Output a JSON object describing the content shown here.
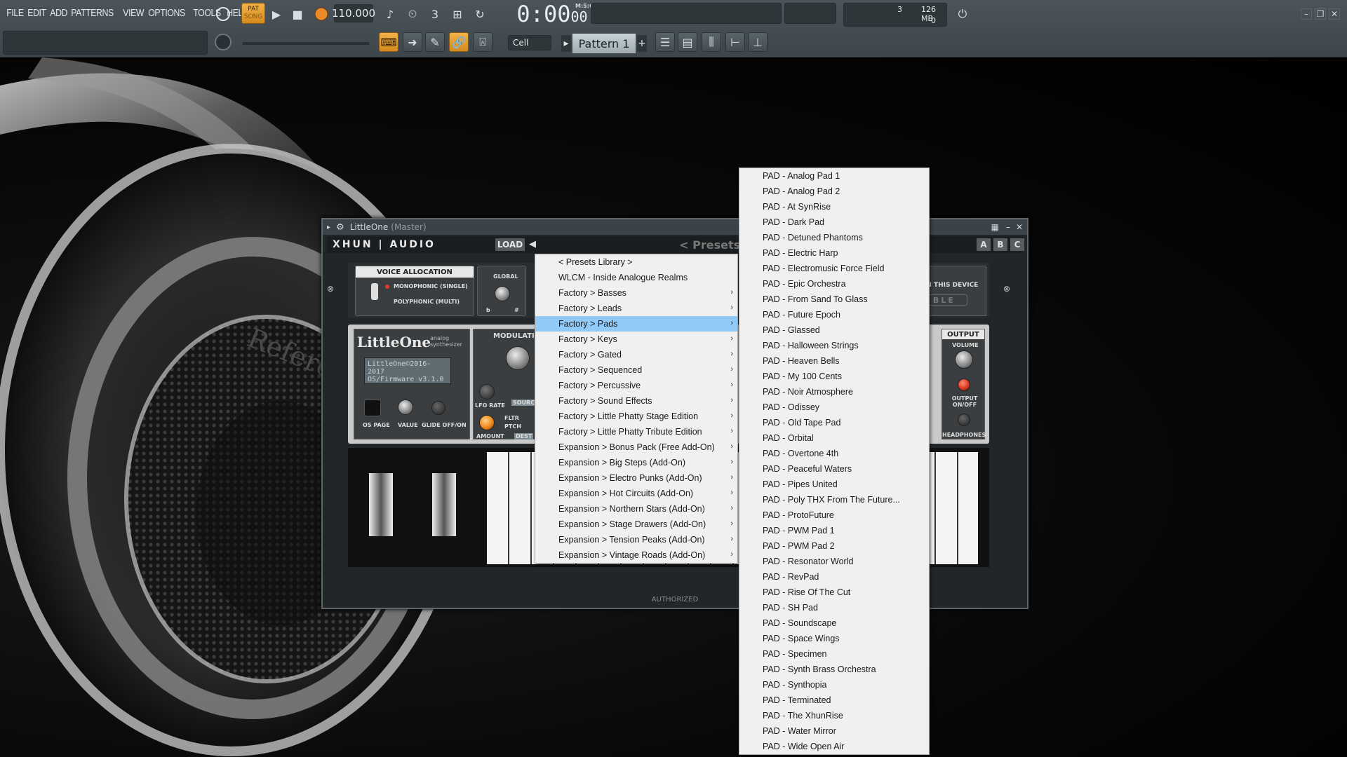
{
  "menubar": [
    "FILE",
    "EDIT",
    "ADD",
    "PATTERNS",
    "VIEW",
    "OPTIONS",
    "TOOLS",
    "HELP"
  ],
  "transport": {
    "pat_label": "PAT",
    "song_label": "SONG",
    "tempo": "110.000",
    "time_main": "0:00",
    "time_sub": "00",
    "time_unit": "M:S:CS"
  },
  "cpu": {
    "voices": "3",
    "memory": "126 MB",
    "second": "0"
  },
  "toolbar2": {
    "snap": "Cell",
    "pattern": "Pattern 1"
  },
  "plugin": {
    "title": "LittleOne",
    "subtitle": "(Master)",
    "brand": "XHUN | AUDIO",
    "load": "LOAD",
    "preset_title": "< Presets Library >",
    "abc": [
      "A",
      "B",
      "C"
    ],
    "voice_allocation": "VOICE ALLOCATION",
    "mono": "MONOPHONIC (SINGLE)",
    "poly": "POLYPHONIC (MULTI)",
    "global": "GLOBAL",
    "modulation": "MODULATIO",
    "in_device": "IN THIS DEVICE",
    "device_state": "BLE",
    "synth_name": "LittleOne",
    "synth_sub": "analog synthesizer",
    "lcd_line1": "LittleOne©2016-2017",
    "lcd_line2": "OS/Firmware   v3.1.0",
    "os_page": "OS PAGE",
    "value": "VALUE",
    "glide": "GLIDE OFF/ON",
    "lfo_rate": "LFO RATE",
    "amount": "AMOUNT",
    "source": "SOURC",
    "dest": "DEST",
    "fltr": "FLTR",
    "ptch": "PTCH",
    "output": "OUTPUT",
    "volume": "VOLUME",
    "output_onoff": "OUTPUT ON/OFF",
    "headphones": "HEADPHONES",
    "flat": "b",
    "sharp": "#",
    "authorized": "AUTHORIZED"
  },
  "menu1": [
    {
      "label": "< Presets Library >",
      "sub": false
    },
    {
      "label": "WLCM - Inside Analogue Realms",
      "sub": false
    },
    {
      "label": "Factory > Basses",
      "sub": true
    },
    {
      "label": "Factory > Leads",
      "sub": true
    },
    {
      "label": "Factory > Pads",
      "sub": true,
      "selected": true
    },
    {
      "label": "Factory > Keys",
      "sub": true
    },
    {
      "label": "Factory > Gated",
      "sub": true
    },
    {
      "label": "Factory > Sequenced",
      "sub": true
    },
    {
      "label": "Factory > Percussive",
      "sub": true
    },
    {
      "label": "Factory > Sound Effects",
      "sub": true
    },
    {
      "label": "Factory > Little Phatty Stage Edition",
      "sub": true
    },
    {
      "label": "Factory > Little Phatty Tribute Edition",
      "sub": true
    },
    {
      "label": "Expansion > Bonus Pack (Free Add-On)",
      "sub": true
    },
    {
      "label": "Expansion > Big Steps (Add-On)",
      "sub": true
    },
    {
      "label": "Expansion > Electro Punks (Add-On)",
      "sub": true
    },
    {
      "label": "Expansion > Hot Circuits (Add-On)",
      "sub": true
    },
    {
      "label": "Expansion > Northern Stars (Add-On)",
      "sub": true
    },
    {
      "label": "Expansion > Stage Drawers (Add-On)",
      "sub": true
    },
    {
      "label": "Expansion > Tension Peaks (Add-On)",
      "sub": true
    },
    {
      "label": "Expansion > Vintage Roads (Add-On)",
      "sub": true
    }
  ],
  "menu2": [
    "PAD - Analog Pad 1",
    "PAD - Analog Pad 2",
    "PAD - At SynRise",
    "PAD - Dark Pad",
    "PAD - Detuned Phantoms",
    "PAD - Electric Harp",
    "PAD - Electromusic Force Field",
    "PAD - Epic Orchestra",
    "PAD - From Sand To Glass",
    "PAD - Future Epoch",
    "PAD - Glassed",
    "PAD - Halloween Strings",
    "PAD - Heaven Bells",
    "PAD - My 100 Cents",
    "PAD - Noir Atmosphere",
    "PAD - Odissey",
    "PAD - Old Tape Pad",
    "PAD - Orbital",
    "PAD - Overtone 4th",
    "PAD - Peaceful Waters",
    "PAD - Pipes United",
    "PAD - Poly THX From The Future...",
    "PAD - ProtoFuture",
    "PAD - PWM Pad 1",
    "PAD - PWM Pad 2",
    "PAD - Resonator World",
    "PAD - RevPad",
    "PAD - Rise Of The Cut",
    "PAD - SH Pad",
    "PAD - Soundscape",
    "PAD - Space Wings",
    "PAD - Specimen",
    "PAD - Synth Brass Orchestra",
    "PAD - Synthopia",
    "PAD - Terminated",
    "PAD - The XhunRise",
    "PAD - Water Mirror",
    "PAD - Wide Open Air"
  ],
  "background": {
    "headphone_text": "Reference"
  }
}
